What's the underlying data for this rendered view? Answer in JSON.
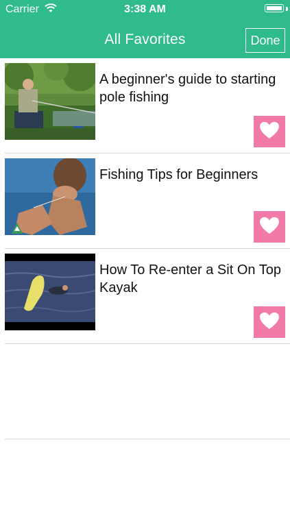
{
  "status_bar": {
    "carrier": "Carrier",
    "time": "3:38 AM",
    "wifi_icon": "wifi-icon",
    "battery_icon": "battery-icon"
  },
  "nav": {
    "title": "All Favorites",
    "done_label": "Done"
  },
  "colors": {
    "header": "#2fbb8c",
    "favorite_button": "#f27aa8",
    "divider": "#d8d8d8"
  },
  "favorites": [
    {
      "title": "A beginner's guide to starting pole fishing",
      "thumbnail": "man-fishing-by-lake",
      "favorite_icon": "heart-icon"
    },
    {
      "title": "Fishing Tips for Beginners",
      "thumbnail": "hands-tying-fishing-hook",
      "favorite_icon": "heart-icon"
    },
    {
      "title": "How To Re-enter a Sit On Top Kayak",
      "thumbnail": "yellow-kayak-in-water",
      "favorite_icon": "heart-icon"
    }
  ]
}
